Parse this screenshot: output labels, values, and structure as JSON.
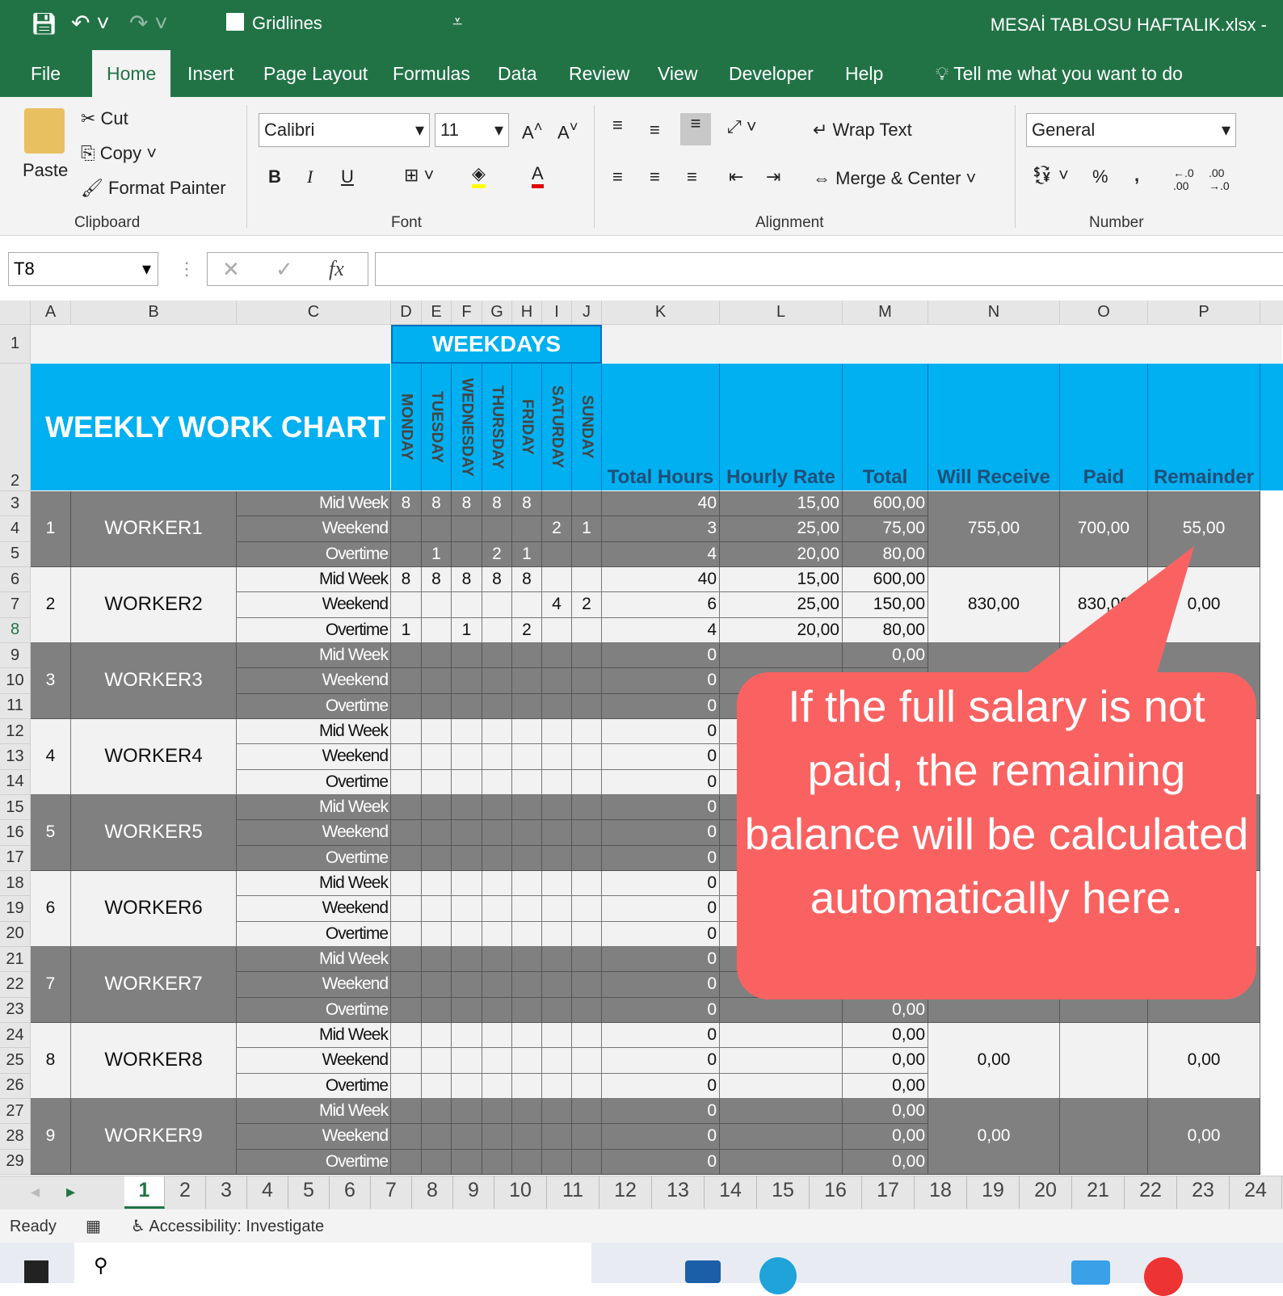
{
  "titlebar": {
    "gridlines_label": "Gridlines",
    "filename": "MESAİ TABLOSU HAFTALIK.xlsx  -"
  },
  "tabs": [
    "File",
    "Home",
    "Insert",
    "Page Layout",
    "Formulas",
    "Data",
    "Review",
    "View",
    "Developer",
    "Help"
  ],
  "tell_me": "Tell me what you want to do",
  "ribbon": {
    "paste": "Paste",
    "cut": "Cut",
    "copy": "Copy",
    "format_painter": "Format Painter",
    "clipboard": "Clipboard",
    "font_name": "Calibri",
    "font_size": "11",
    "font": "Font",
    "bold": "B",
    "italic": "I",
    "underline": "U",
    "wrap_text": "Wrap Text",
    "merge_center": "Merge & Center",
    "alignment": "Alignment",
    "number_format": "General",
    "number": "Number",
    "percent": "%",
    "comma": ","
  },
  "formula_bar": {
    "name_box": "T8",
    "fx": "fx",
    "value": ""
  },
  "columns": [
    "A",
    "B",
    "C",
    "D",
    "E",
    "F",
    "G",
    "H",
    "I",
    "J",
    "K",
    "L",
    "M",
    "N",
    "O",
    "P"
  ],
  "sheet": {
    "weekdays": "WEEKDAYS",
    "title": "WEEKLY WORK CHART",
    "days": [
      "MONDAY",
      "TUESDAY",
      "WEDNESDAY",
      "THURSDAY",
      "FRIDAY",
      "SATURDAY",
      "SUNDAY"
    ],
    "headers": [
      "Total Hours",
      "Hourly Rate",
      "Total",
      "Will Receive",
      "Paid",
      "Remainder"
    ],
    "row_labels": [
      "Mid Week",
      "Weekend",
      "Overtime"
    ],
    "workers": [
      {
        "no": "1",
        "name": "WORKER1",
        "rows": [
          {
            "days": [
              "8",
              "8",
              "8",
              "8",
              "8",
              "",
              ""
            ],
            "hours": "40",
            "rate": "15,00",
            "total": "600,00"
          },
          {
            "days": [
              "",
              "",
              "",
              "",
              "",
              "2",
              "1"
            ],
            "hours": "3",
            "rate": "25,00",
            "total": "75,00"
          },
          {
            "days": [
              "",
              "1",
              "",
              "2",
              "1",
              "",
              ""
            ],
            "hours": "4",
            "rate": "20,00",
            "total": "80,00"
          }
        ],
        "receive": "755,00",
        "paid": "700,00",
        "remainder": "55,00"
      },
      {
        "no": "2",
        "name": "WORKER2",
        "rows": [
          {
            "days": [
              "8",
              "8",
              "8",
              "8",
              "8",
              "",
              ""
            ],
            "hours": "40",
            "rate": "15,00",
            "total": "600,00"
          },
          {
            "days": [
              "",
              "",
              "",
              "",
              "",
              "4",
              "2"
            ],
            "hours": "6",
            "rate": "25,00",
            "total": "150,00"
          },
          {
            "days": [
              "1",
              "",
              "1",
              "",
              "2",
              "",
              ""
            ],
            "hours": "4",
            "rate": "20,00",
            "total": "80,00"
          }
        ],
        "receive": "830,00",
        "paid": "830,00",
        "remainder": "0,00"
      },
      {
        "no": "3",
        "name": "WORKER3",
        "rows": [
          {
            "days": [],
            "hours": "0",
            "rate": "",
            "total": "0,00"
          },
          {
            "days": [],
            "hours": "0",
            "rate": "",
            "total": ""
          },
          {
            "days": [],
            "hours": "0",
            "rate": "",
            "total": ""
          }
        ],
        "receive": "",
        "paid": "",
        "remainder": ""
      },
      {
        "no": "4",
        "name": "WORKER4",
        "rows": [
          {
            "days": [],
            "hours": "0",
            "rate": "",
            "total": ""
          },
          {
            "days": [],
            "hours": "0",
            "rate": "",
            "total": ""
          },
          {
            "days": [],
            "hours": "0",
            "rate": "",
            "total": ""
          }
        ],
        "receive": "",
        "paid": "",
        "remainder": ""
      },
      {
        "no": "5",
        "name": "WORKER5",
        "rows": [
          {
            "days": [],
            "hours": "0",
            "rate": "",
            "total": ""
          },
          {
            "days": [],
            "hours": "0",
            "rate": "",
            "total": ""
          },
          {
            "days": [],
            "hours": "0",
            "rate": "",
            "total": ""
          }
        ],
        "receive": "",
        "paid": "",
        "remainder": ""
      },
      {
        "no": "6",
        "name": "WORKER6",
        "rows": [
          {
            "days": [],
            "hours": "0",
            "rate": "",
            "total": ""
          },
          {
            "days": [],
            "hours": "0",
            "rate": "",
            "total": ""
          },
          {
            "days": [],
            "hours": "0",
            "rate": "",
            "total": ""
          }
        ],
        "receive": "",
        "paid": "",
        "remainder": ""
      },
      {
        "no": "7",
        "name": "WORKER7",
        "rows": [
          {
            "days": [],
            "hours": "0",
            "rate": "",
            "total": ""
          },
          {
            "days": [],
            "hours": "0",
            "rate": "",
            "total": ""
          },
          {
            "days": [],
            "hours": "0",
            "rate": "",
            "total": "0,00"
          }
        ],
        "receive": "",
        "paid": "",
        "remainder": ""
      },
      {
        "no": "8",
        "name": "WORKER8",
        "rows": [
          {
            "days": [],
            "hours": "0",
            "rate": "",
            "total": "0,00"
          },
          {
            "days": [],
            "hours": "0",
            "rate": "",
            "total": "0,00"
          },
          {
            "days": [],
            "hours": "0",
            "rate": "",
            "total": "0,00"
          }
        ],
        "receive": "0,00",
        "paid": "",
        "remainder": "0,00"
      },
      {
        "no": "9",
        "name": "WORKER9",
        "rows": [
          {
            "days": [],
            "hours": "0",
            "rate": "",
            "total": "0,00"
          },
          {
            "days": [],
            "hours": "0",
            "rate": "",
            "total": "0,00"
          },
          {
            "days": [],
            "hours": "0",
            "rate": "",
            "total": "0,00"
          }
        ],
        "receive": "0,00",
        "paid": "",
        "remainder": "0,00"
      }
    ]
  },
  "callout": "If the full salary is not paid, the remaining balance will be calculated automatically here.",
  "sheet_tabs": [
    "1",
    "2",
    "3",
    "4",
    "5",
    "6",
    "7",
    "8",
    "9",
    "10",
    "11",
    "12",
    "13",
    "14",
    "15",
    "16",
    "17",
    "18",
    "19",
    "20",
    "21",
    "22",
    "23",
    "24"
  ],
  "status": {
    "ready": "Ready",
    "accessibility": "Accessibility: Investigate"
  },
  "colors": {
    "excel_green": "#217346",
    "header_blue": "#00b0f0",
    "dark_row": "#808080",
    "light_row": "#f2f2f2",
    "callout": "#fa6262"
  }
}
